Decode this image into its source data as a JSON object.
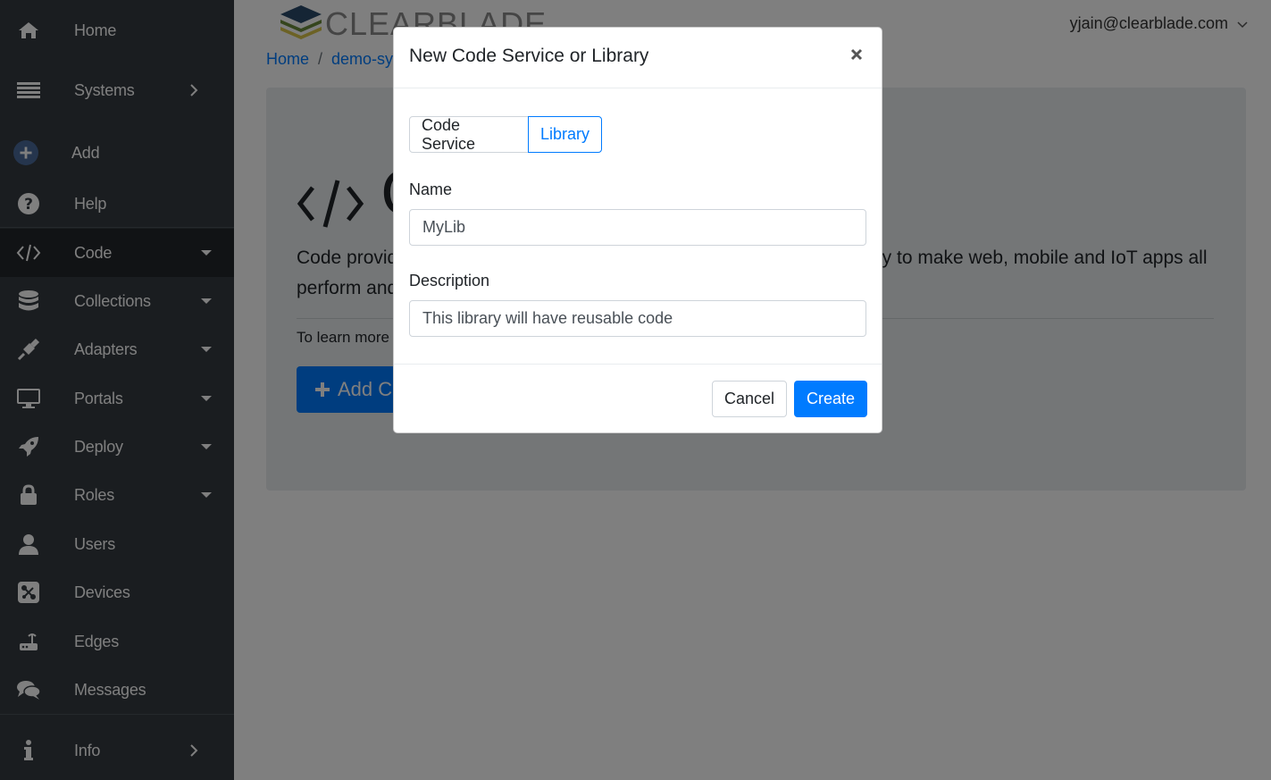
{
  "sidebar": {
    "items": [
      {
        "label": "Home",
        "icon": "home-icon"
      },
      {
        "label": "Systems",
        "icon": "list-icon"
      },
      {
        "label": "Add",
        "icon": "plus-circle-icon"
      },
      {
        "label": "Help",
        "icon": "question-circle-icon"
      },
      {
        "label": "Code",
        "icon": "code-icon"
      },
      {
        "label": "Collections",
        "icon": "database-icon"
      },
      {
        "label": "Adapters",
        "icon": "plug-icon"
      },
      {
        "label": "Portals",
        "icon": "desktop-icon"
      },
      {
        "label": "Deploy",
        "icon": "rocket-icon"
      },
      {
        "label": "Roles",
        "icon": "lock-icon"
      },
      {
        "label": "Users",
        "icon": "user-icon"
      },
      {
        "label": "Devices",
        "icon": "devices-icon"
      },
      {
        "label": "Edges",
        "icon": "router-icon"
      },
      {
        "label": "Messages",
        "icon": "comments-icon"
      },
      {
        "label": "Info",
        "icon": "info-icon"
      }
    ],
    "active": "Code"
  },
  "header": {
    "logo_text": "CLEARBLADE",
    "user_email": "yjain@clearblade.com"
  },
  "breadcrumb": {
    "home": "Home",
    "separator": "/",
    "system": "demo-sy"
  },
  "jumbotron": {
    "title_fragment": "C",
    "lead_left": "Code provid",
    "lead_right": "ary to make web, mobile and IoT apps all",
    "lead_line2": "perform and",
    "learn_more": "To learn more",
    "add_button": "Add C"
  },
  "modal": {
    "title": "New Code Service or Library",
    "tabs": [
      "Code Service",
      "Library"
    ],
    "selected_tab": "Library",
    "name_label": "Name",
    "name_value": "MyLib",
    "description_label": "Description",
    "description_value": "This library will have reusable code",
    "cancel_label": "Cancel",
    "create_label": "Create"
  },
  "colors": {
    "sidebar_bg": "#343a40",
    "primary": "#007bff",
    "overlay": "rgba(0,0,0,0.5)"
  }
}
